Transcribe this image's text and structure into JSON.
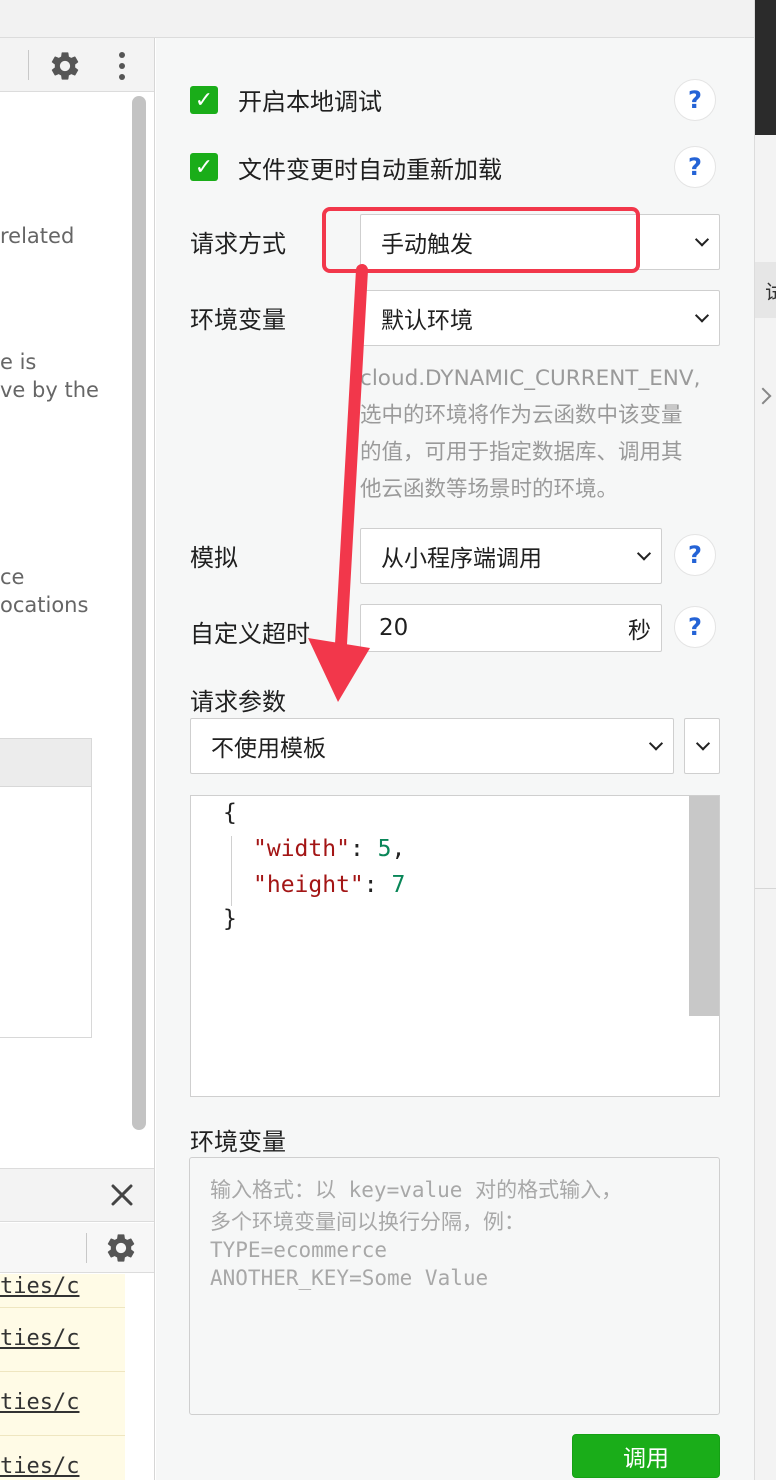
{
  "left_pane": {
    "text_fragments": [
      "related",
      "e is",
      "ve by the",
      "ce",
      "ocations"
    ],
    "log_links": [
      "ties/c",
      "ties/c",
      "ties/c",
      "ties/c"
    ]
  },
  "panel": {
    "local_debug": {
      "label": "开启本地调试",
      "checked": true
    },
    "auto_reload": {
      "label": "文件变更时自动重新加载",
      "checked": true
    },
    "request_method": {
      "label": "请求方式",
      "value": "手动触发"
    },
    "env_variable": {
      "label": "环境变量",
      "value": "默认环境",
      "description": [
        "cloud.DYNAMIC_CURRENT_ENV,",
        "选中的环境将作为云函数中该变量",
        "的值，可用于指定数据库、调用其",
        "他云函数等场景时的环境。"
      ]
    },
    "simulate": {
      "label": "模拟",
      "value": "从小程序端调用"
    },
    "timeout": {
      "label": "自定义超时",
      "value": "20",
      "unit": "秒"
    },
    "request_params": {
      "label": "请求参数",
      "template_value": "不使用模板",
      "code": {
        "open": "{",
        "width_key": "\"width\"",
        "width_value": "5",
        "height_key": "\"height\"",
        "height_value": "7",
        "close": "}"
      }
    },
    "env_vars_input": {
      "label": "环境变量",
      "placeholder_lines": [
        "输入格式：以 key=value 对的格式输入，",
        "多个环境变量间以换行分隔，例：",
        "TYPE=ecommerce",
        "ANOTHER_KEY=Some Value"
      ]
    },
    "invoke_button": "调用",
    "help_glyph": "?"
  },
  "right_strip": {
    "fragment": "试"
  },
  "icons": [
    "gear-icon",
    "more-vertical-icon",
    "close-icon",
    "checkmark-icon",
    "chevron-down-icon",
    "chevron-right-icon",
    "arrow-annotation"
  ],
  "colors": {
    "accent_green": "#1aad19",
    "help_blue": "#2463d6",
    "annotation_red": "#f2374b",
    "json_key": "#a31515",
    "json_number": "#098658"
  }
}
